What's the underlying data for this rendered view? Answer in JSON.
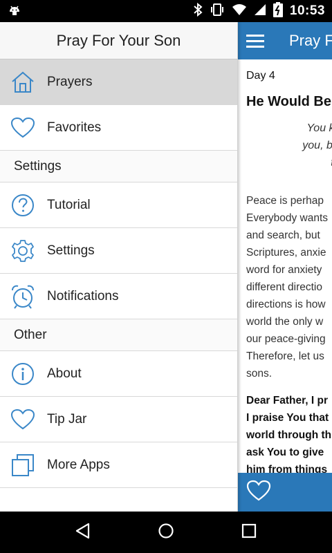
{
  "status_bar": {
    "time": "10:53",
    "icons": [
      "android-debug-icon",
      "bluetooth-icon",
      "vibrate-icon",
      "wifi-icon",
      "signal-icon",
      "battery-charging-icon"
    ]
  },
  "drawer": {
    "title": "Pray For Your Son",
    "items_top": [
      {
        "label": "Prayers",
        "icon": "home-icon",
        "active": true
      },
      {
        "label": "Favorites",
        "icon": "heart-icon",
        "active": false
      }
    ],
    "section_settings": "Settings",
    "items_settings": [
      {
        "label": "Tutorial",
        "icon": "help-circle-icon"
      },
      {
        "label": "Settings",
        "icon": "gear-icon"
      },
      {
        "label": "Notifications",
        "icon": "alarm-clock-icon"
      }
    ],
    "section_other": "Other",
    "items_other": [
      {
        "label": "About",
        "icon": "info-circle-icon"
      },
      {
        "label": "Tip Jar",
        "icon": "heart-icon"
      },
      {
        "label": "More Apps",
        "icon": "stacked-squares-icon"
      }
    ]
  },
  "main": {
    "toolbar_title": "Pray F",
    "day": "Day 4",
    "heading": "He Would Be",
    "verse_lines": [
      "You keep him i",
      "you, because he",
      "the L"
    ],
    "body_lines": [
      "Peace is perhap",
      "Everybody wants",
      "and search, but",
      "Scriptures, anxie",
      "word for anxiety",
      "different directio",
      "directions is how",
      "world the only w",
      "our peace-giving",
      "Therefore, let us",
      "sons."
    ],
    "prayer_lines": [
      "Dear Father, I pr",
      "I praise You that",
      "world through th",
      "ask You to give",
      "him from things"
    ]
  },
  "colors": {
    "accent": "#2a78b8",
    "icon_blue": "#3a87c8",
    "active_row": "#d8d8d8"
  }
}
